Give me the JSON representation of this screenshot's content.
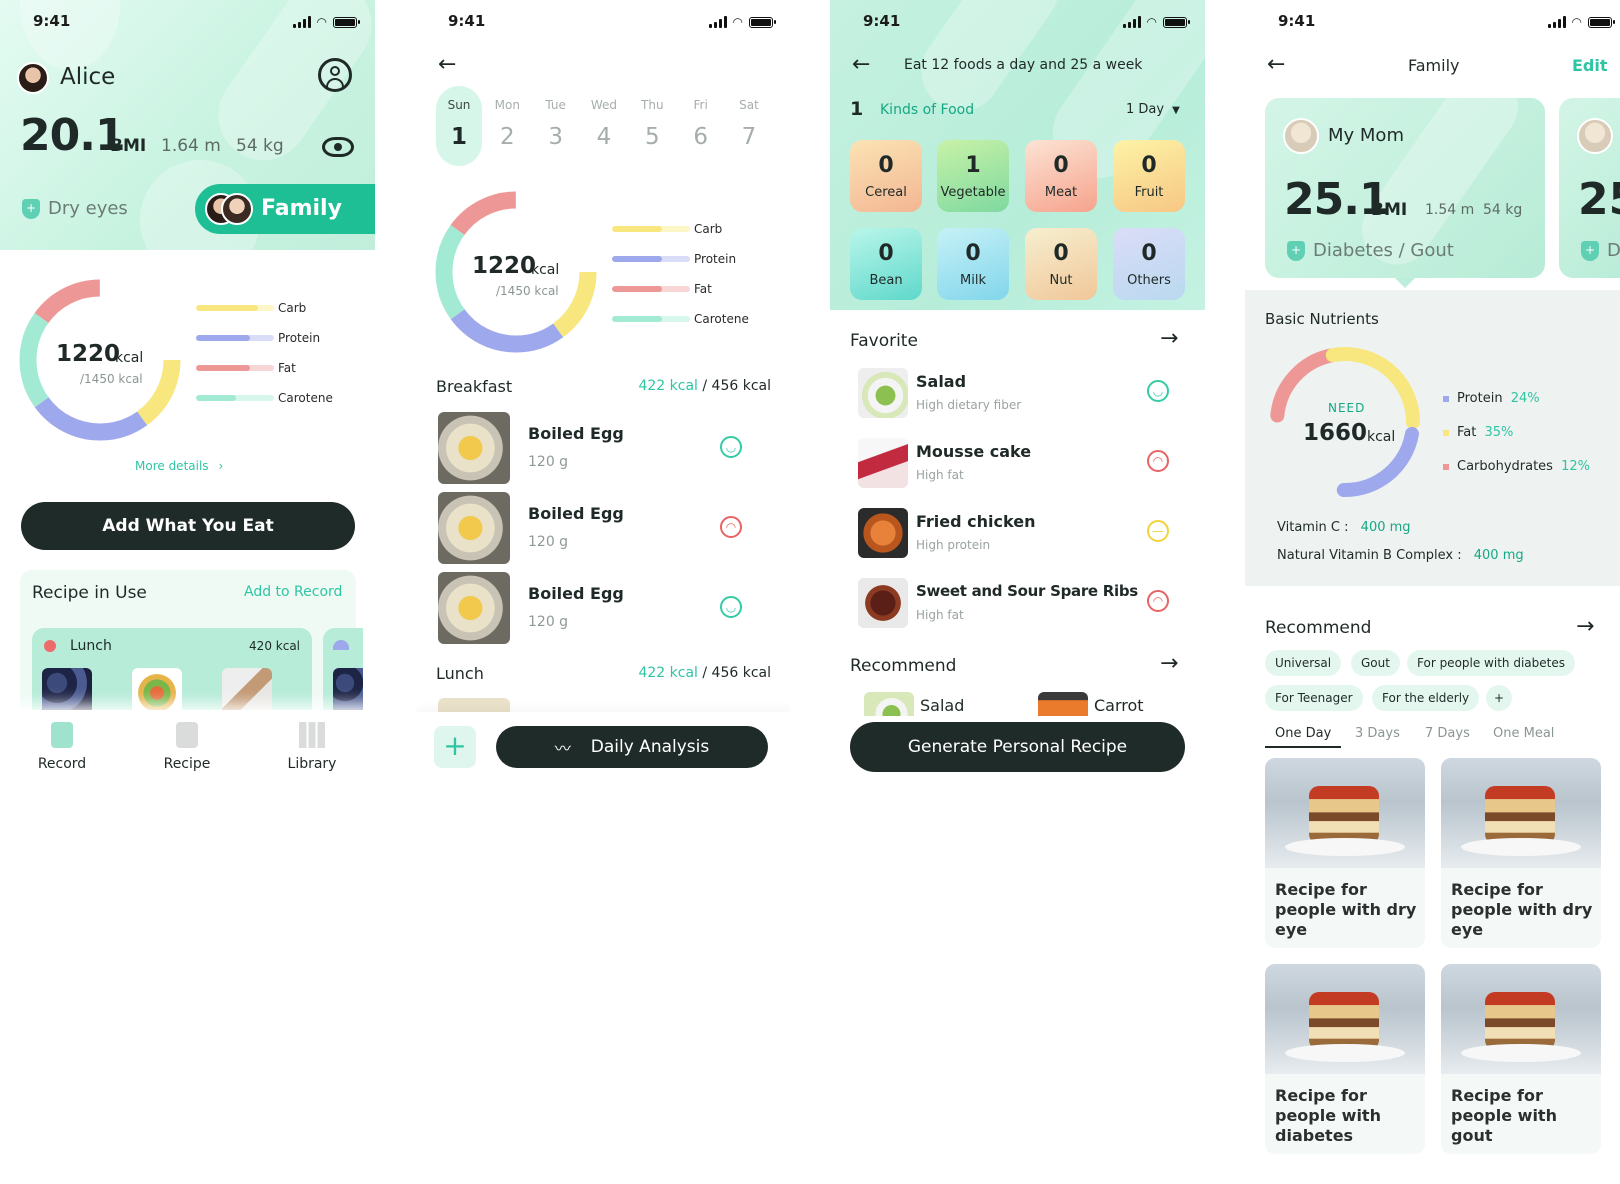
{
  "status_time": "9:41",
  "screen1": {
    "user_name": "Alice",
    "bmi_value": "20.1",
    "bmi_label": "BMI",
    "height": "1.64 m",
    "weight": "54 kg",
    "condition": "Dry eyes",
    "family_label": "Family",
    "kcal_value": "1220",
    "kcal_unit": "kcal",
    "kcal_target": "/1450 kcal",
    "legend": [
      "Carb",
      "Protein",
      "Fat",
      "Carotene"
    ],
    "more_details": "More details",
    "add_button": "Add What You Eat",
    "recipe_title": "Recipe in Use",
    "add_to_record": "Add to Record",
    "lunch_label": "Lunch",
    "lunch_kcal": "420 kcal",
    "nav": [
      "Record",
      "Recipe",
      "Library"
    ]
  },
  "screen2": {
    "days": [
      {
        "name": "Sun",
        "num": "1"
      },
      {
        "name": "Mon",
        "num": "2"
      },
      {
        "name": "Tue",
        "num": "3"
      },
      {
        "name": "Wed",
        "num": "4"
      },
      {
        "name": "Thu",
        "num": "5"
      },
      {
        "name": "Fri",
        "num": "6"
      },
      {
        "name": "Sat",
        "num": "7"
      }
    ],
    "kcal_value": "1220",
    "kcal_unit": "kcal",
    "kcal_target": "/1450 kcal",
    "legend": [
      "Carb",
      "Protein",
      "Fat",
      "Carotene"
    ],
    "breakfast": "Breakfast",
    "lunch": "Lunch",
    "meal_kcal": "422 kcal",
    "meal_target": "/ 456 kcal",
    "items": [
      {
        "name": "Boiled Egg",
        "weight": "120 g",
        "mood": "happy"
      },
      {
        "name": "Boiled Egg",
        "weight": "120 g",
        "mood": "sad"
      },
      {
        "name": "Boiled Egg",
        "weight": "120 g",
        "mood": "happy"
      }
    ],
    "daily_analysis": "Daily Analysis"
  },
  "screen3": {
    "title": "Eat 12 foods a day and 25 a week",
    "kinds_count": "1",
    "kinds_label": "Kinds of Food",
    "period": "1 Day",
    "tiles": [
      {
        "count": "0",
        "label": "Cereal"
      },
      {
        "count": "1",
        "label": "Vegetable"
      },
      {
        "count": "0",
        "label": "Meat"
      },
      {
        "count": "0",
        "label": "Fruit"
      },
      {
        "count": "0",
        "label": "Bean"
      },
      {
        "count": "0",
        "label": "Milk"
      },
      {
        "count": "0",
        "label": "Nut"
      },
      {
        "count": "0",
        "label": "Others"
      }
    ],
    "favorite": "Favorite",
    "favorites": [
      {
        "name": "Salad",
        "sub": "High dietary fiber",
        "mood": "happy"
      },
      {
        "name": "Mousse cake",
        "sub": "High fat",
        "mood": "sad"
      },
      {
        "name": "Fried chicken",
        "sub": "High protein",
        "mood": "neutral"
      },
      {
        "name": "Sweet and Sour Spare Ribs",
        "sub": "High fat",
        "mood": "sad"
      }
    ],
    "recommend": "Recommend",
    "rec_items": [
      "Salad",
      "Carrot"
    ],
    "generate": "Generate Personal Recipe"
  },
  "screen4": {
    "title": "Family",
    "edit": "Edit",
    "member": "My Mom",
    "bmi_value": "25.1",
    "bmi_label": "BMI",
    "height": "1.54 m",
    "weight": "54 kg",
    "condition": "Diabetes / Gout",
    "peek_bmi": "25",
    "peek_condition": "D",
    "basic_nutrients": "Basic Nutrients",
    "need_label": "NEED",
    "need_value": "1660",
    "need_unit": "kcal",
    "nutrients": [
      {
        "name": "Protein",
        "pct": "24%"
      },
      {
        "name": "Fat",
        "pct": "35%"
      },
      {
        "name": "Carbohydrates",
        "pct": "12%"
      }
    ],
    "vitamin_c_label": "Vitamin C :",
    "vitamin_c_value": "400 mg",
    "vitamin_b_label": "Natural Vitamin B Complex :",
    "vitamin_b_value": "400 mg",
    "recommend": "Recommend",
    "chips": [
      "Universal",
      "Gout",
      "For people with diabetes",
      "For Teenager",
      "For the elderly",
      "+"
    ],
    "tabs": [
      "One Day",
      "3 Days",
      "7 Days",
      "One Meal"
    ],
    "recipes": [
      "Recipe for people with dry eye",
      "Recipe for people with dry eye",
      "Recipe for people with diabetes",
      "Recipe for people with gout"
    ]
  },
  "colors": {
    "accent": "#2fc5a3",
    "dark_button": "#1f2b28",
    "carb": "#f8e77e",
    "protein": "#9ea8ec",
    "fat": "#ee9797",
    "carotene": "#a2ead3"
  }
}
